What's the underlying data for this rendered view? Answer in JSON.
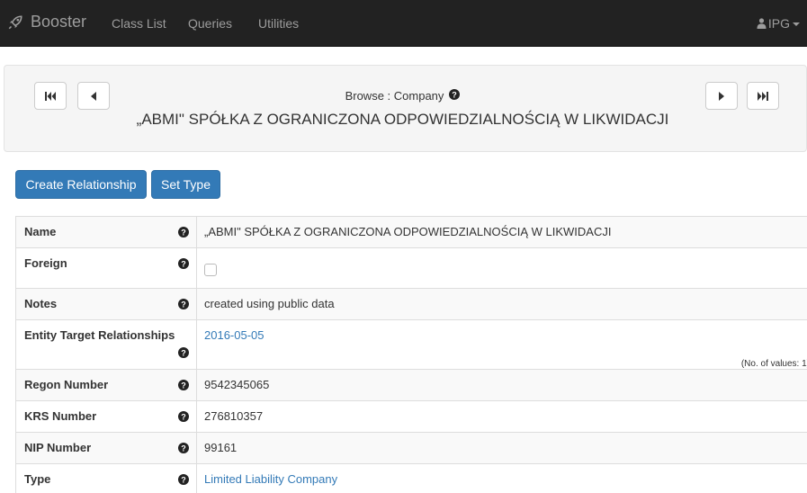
{
  "navbar": {
    "brand": "Booster",
    "links": [
      "Class List",
      "Queries",
      "Utilities"
    ],
    "user": "IPG"
  },
  "browse": {
    "label": "Browse : Company",
    "title": "„ABMI\" SPÓŁKA Z OGRANICZONA ODPOWIEDZIALNOŚCIĄ W LIKWIDACJI"
  },
  "actions": {
    "create_relationship": "Create Relationship",
    "set_type": "Set Type"
  },
  "properties": [
    {
      "label": "Name",
      "value": "„ABMI\" SPÓŁKA Z OGRANICZONA ODPOWIEDZIALNOŚCIĄ W LIKWIDACJI"
    },
    {
      "label": "Foreign",
      "checked": false
    },
    {
      "label": "Notes",
      "value": "created using public data"
    },
    {
      "label": "Entity Target Relationships",
      "value": "2016-05-05",
      "note": "(No. of values: 1)"
    },
    {
      "label": "Regon Number",
      "value": "9542345065"
    },
    {
      "label": "KRS Number",
      "value": "276810357"
    },
    {
      "label": "NIP Number",
      "value": "99161"
    },
    {
      "label": "Type",
      "value": "Limited Liability Company"
    }
  ],
  "colors": {
    "navbar_bg": "#222222",
    "primary": "#337ab7",
    "link": "#337ab7"
  }
}
